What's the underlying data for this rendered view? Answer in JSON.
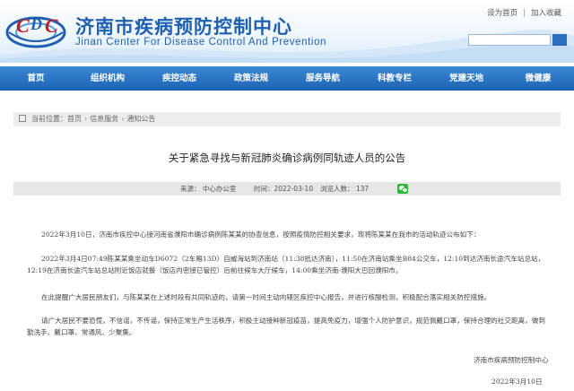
{
  "header": {
    "logo_icon": "cdc-globe-logo",
    "title": "济南市疾病预防控制中心",
    "subtitle": "Jinan Center For Disease Control And Prevention",
    "top_links": [
      "设为首页",
      "加入收藏"
    ],
    "search": {
      "value": "",
      "placeholder": ""
    }
  },
  "nav": {
    "items": [
      "首页",
      "组织机构",
      "疾控动态",
      "政策法规",
      "服务导航",
      "科教专栏",
      "党建天地",
      "微健康"
    ]
  },
  "breadcrumb": {
    "prefix": "当前位置：",
    "items": [
      "首页",
      "信息服务",
      "通知公告"
    ],
    "separator": "›"
  },
  "article": {
    "title": "关于紧急寻找与新冠肺炎确诊病例同轨迹人员的公告",
    "meta": {
      "source": "来源：  中心办公室",
      "time": "时间：2022-03-10",
      "views": "浏览人数：  137"
    },
    "paragraphs": [
      "2022年3月10日，济南市疾控中心接河南省濮阳市确诊病例陈某某的协查信息，按照疫情防控相关要求，现将陈某某在我市的活动轨迹公布如下：",
      "2022年3月4日07:49陈某某乘坐动车D6072（2车厢13D）自威海站到济南站（11:38抵达济南），11:50在济南站乘坐B84公交车，12:10到达济南长途汽车站总站，12:19在济南长途汽车站总站附近饭店就餐（饭店内密接已管控）后前往候车大厅候车，14:00乘坐济南-濮阳大巴回濮阳市。",
      "在此提醒广大居民朋友们，与陈某某在上述时段有共同轨迹的，请第一时间主动向辖区疾控中心报告，并进行核酸检测，积极配合落实相关防控措施。",
      "请广大居民不要恐慌，不信谣，不传谣，保持正常生产生活秩序，积极主动接种新冠疫苗，提高免疫力，增强个人防护意识，规范佩戴口罩，保持合理的社交距离，做到勤洗手、戴口罩、常通风、少聚集。"
    ],
    "signature": "济南市疾病预防控制中心",
    "date": "2022年3月10日"
  },
  "colors": {
    "brand_blue": "#1f5fb0",
    "nav_blue": "#1d62b3",
    "wechat_green": "#2fb83a"
  }
}
